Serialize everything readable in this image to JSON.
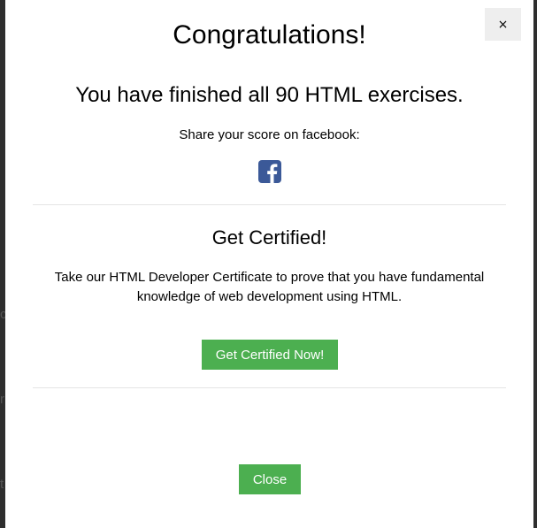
{
  "modal": {
    "close_x_label": "×",
    "title": "Congratulations!",
    "subtitle": "You have finished all 90 HTML exercises.",
    "share_text": "Share your score on facebook:",
    "share_icon": "facebook-icon",
    "certificate": {
      "title": "Get Certified!",
      "description": "Take our HTML Developer Certificate to prove that you have fundamental knowledge of web development using HTML.",
      "button_label": "Get Certified Now!"
    },
    "close_button_label": "Close"
  },
  "background": {
    "chars": [
      "c",
      "r",
      "t"
    ]
  },
  "colors": {
    "accent_green": "#4caf50",
    "facebook_blue": "#3b5998",
    "overlay": "#3a3a3a"
  }
}
